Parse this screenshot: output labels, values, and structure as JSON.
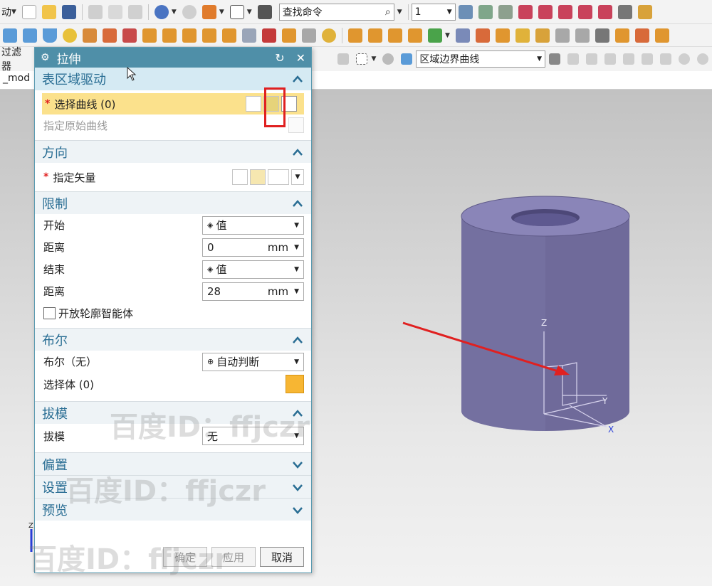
{
  "toolbar": {
    "row1_left_label": "动",
    "search": {
      "value": "查找命令"
    },
    "layer_value": "1"
  },
  "filter_bar": {
    "filter_label": "过滤器",
    "curve_rule": "区域边界曲线"
  },
  "tab": {
    "label": "_mod"
  },
  "dialog": {
    "title": "拉伸",
    "sections": {
      "face_drive": {
        "title": "表区域驱动",
        "select_curve_label": "选择曲线 (0)",
        "specify_original_curve": "指定原始曲线"
      },
      "direction": {
        "title": "方向",
        "specify_vector": "指定矢量"
      },
      "limits": {
        "title": "限制",
        "start_label": "开始",
        "start_value": "值",
        "start_distance_label": "距离",
        "start_distance_value": "0",
        "end_label": "结束",
        "end_value": "值",
        "end_distance_label": "距离",
        "end_distance_value": "28",
        "unit": "mm",
        "open_profile_label": "开放轮廓智能体"
      },
      "boolean": {
        "title": "布尔",
        "boolean_label": "布尔（无）",
        "boolean_value": "自动判断",
        "select_body_label": "选择体 (0)"
      },
      "draft": {
        "title": "拔模",
        "draft_label": "拔模",
        "draft_value": "无"
      },
      "offset": {
        "title": "偏置"
      },
      "settings": {
        "title": "设置"
      },
      "preview": {
        "title": "预览"
      }
    },
    "buttons": {
      "ok": "确定",
      "apply": "应用",
      "cancel": "取消"
    }
  },
  "viewport": {
    "axis_labels": {
      "z": "Z",
      "y": "Y",
      "x": "X"
    },
    "triad_z": "Z"
  },
  "watermarks": [
    "百度ID：ffjczr",
    "百度ID：ffjczr",
    "百度ID：ffjczr"
  ],
  "colors": {
    "dialog_title_bg": "#4f8fa8",
    "section_title": "#2a6e94",
    "highlight_row": "#fbe18c",
    "cylinder": "#6f6a9a",
    "arrow": "#e02020"
  }
}
